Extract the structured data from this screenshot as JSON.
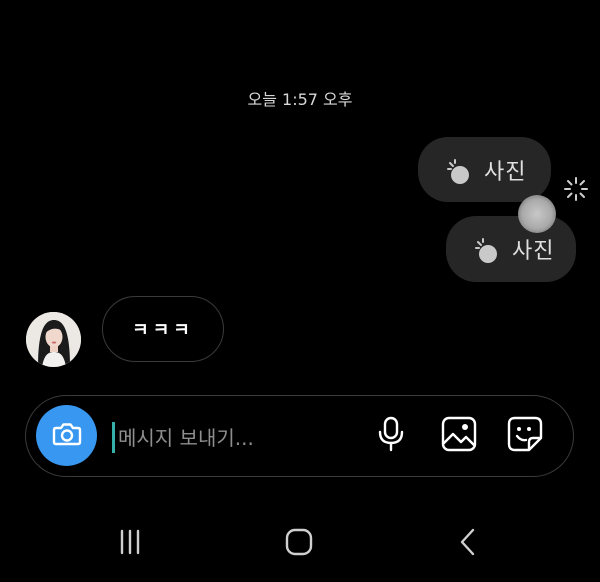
{
  "chat": {
    "timestamp": "오늘 1:57 오후",
    "sent_messages": [
      {
        "type": "photo",
        "icon": "photo-sparkle-icon",
        "label": "사진"
      },
      {
        "type": "photo",
        "icon": "photo-sparkle-icon",
        "label": "사진"
      }
    ],
    "received_messages": [
      {
        "avatar": "user-avatar",
        "text": "ㅋㅋㅋ"
      }
    ],
    "sending_indicator_icon": "loading-spinner-icon"
  },
  "composer": {
    "placeholder": "메시지 보내기...",
    "value": "",
    "camera_icon": "camera-icon",
    "mic_icon": "microphone-icon",
    "gallery_icon": "image-gallery-icon",
    "sticker_icon": "sticker-icon",
    "accent_color": "#3897f0"
  },
  "navbar": {
    "recents_icon": "recent-apps-icon",
    "home_icon": "home-icon",
    "back_icon": "back-icon"
  }
}
